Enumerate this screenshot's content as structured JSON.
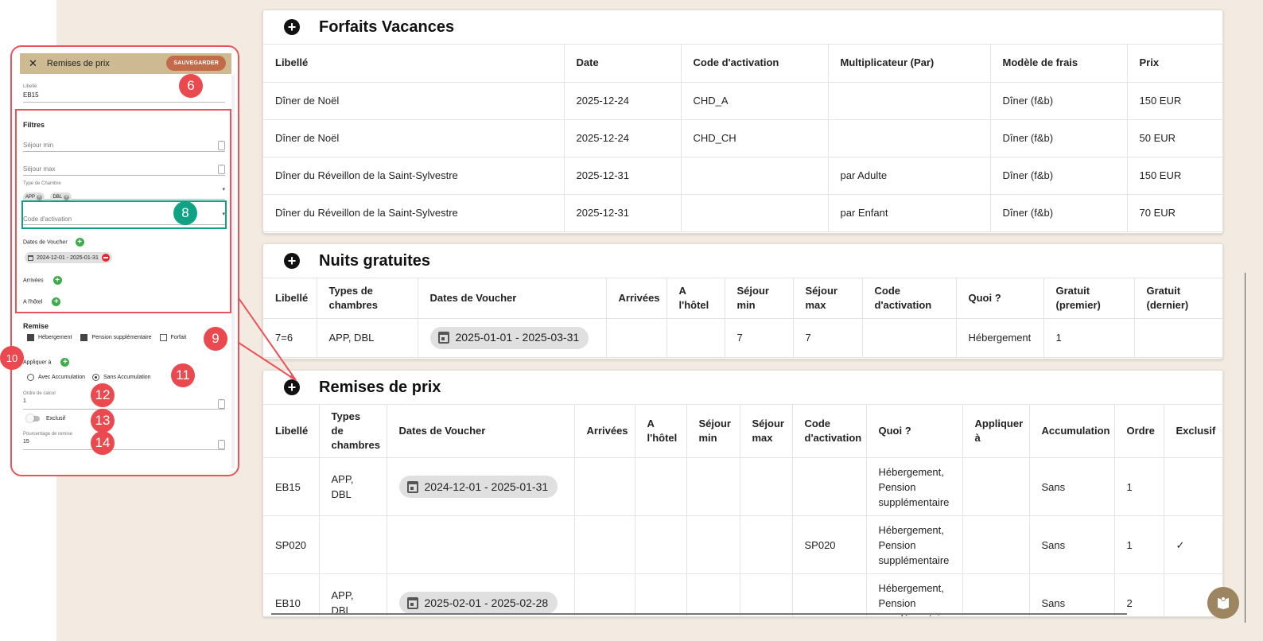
{
  "colors": {
    "accent": "#c26a4a",
    "panel_header": "#cdb992",
    "badge_red": "#ea4a4f",
    "badge_green": "#11a286",
    "page_bg": "#f3ebe1"
  },
  "forfaits": {
    "title": "Forfaits Vacances",
    "headers": [
      "Libellé",
      "Date",
      "Code d'activation",
      "Multiplicateur (Par)",
      "Modèle de frais",
      "Prix"
    ],
    "rows": [
      [
        "Dîner de Noël",
        "2025-12-24",
        "CHD_A",
        "",
        "Dîner (f&b)",
        "150 EUR"
      ],
      [
        "Dîner de Noël",
        "2025-12-24",
        "CHD_CH",
        "",
        "Dîner (f&b)",
        "50 EUR"
      ],
      [
        "Dîner du Réveillon de la Saint-Sylvestre",
        "2025-12-31",
        "",
        "par Adulte",
        "Dîner (f&b)",
        "150 EUR"
      ],
      [
        "Dîner du Réveillon de la Saint-Sylvestre",
        "2025-12-31",
        "",
        "par Enfant",
        "Dîner (f&b)",
        "70 EUR"
      ]
    ]
  },
  "nuits": {
    "title": "Nuits gratuites",
    "headers": [
      "Libellé",
      "Types de chambres",
      "Dates de Voucher",
      "Arrivées",
      "A l'hôtel",
      "Séjour min",
      "Séjour max",
      "Code d'activation",
      "Quoi ?",
      "Gratuit (premier)",
      "Gratuit (dernier)"
    ],
    "rows": [
      [
        "7=6",
        "APP, DBL",
        "2025-01-01 - 2025-03-31",
        "",
        "",
        "7",
        "7",
        "",
        "Hébergement",
        "1",
        ""
      ]
    ]
  },
  "remises": {
    "title": "Remises de prix",
    "headers": [
      "Libellé",
      "Types de chambres",
      "Dates de Voucher",
      "Arrivées",
      "A l'hôtel",
      "Séjour min",
      "Séjour max",
      "Code d'activation",
      "Quoi ?",
      "Appliquer à",
      "Accumulation",
      "Ordre",
      "Exclusif"
    ],
    "rows": [
      [
        "EB15",
        "APP, DBL",
        "2024-12-01 - 2025-01-31",
        "",
        "",
        "",
        "",
        "",
        "Hébergement, Pension supplémentaire",
        "",
        "Sans",
        "1",
        ""
      ],
      [
        "SP020",
        "",
        "",
        "",
        "",
        "",
        "",
        "SP020",
        "Hébergement, Pension supplémentaire",
        "",
        "Sans",
        "1",
        "✓"
      ],
      [
        "EB10",
        "APP, DBL",
        "2025-02-01 - 2025-02-28",
        "",
        "",
        "",
        "",
        "",
        "Hébergement, Pension supplémentaire",
        "",
        "Sans",
        "2",
        ""
      ]
    ]
  },
  "panel": {
    "close": "✕",
    "title": "Remises de prix",
    "save": "SAUVEGARDER",
    "libelle_label": "Libellé",
    "libelle_value": "EB15",
    "filtres": "Filtres",
    "sejour_min": "Séjour min",
    "sejour_max": "Séjour max",
    "type_chambre_label": "Type de Chambre",
    "type_chambre_values": [
      "APP",
      "DBL"
    ],
    "code_activation": "Code d'activation",
    "dates_voucher": "Dates de Voucher",
    "dates_voucher_chip": "2024-12-01 - 2025-01-31",
    "arrivees": "Arrivées",
    "a_lhotel": "A l'hôtel",
    "remise": "Remise",
    "hebergement": "Hébergement",
    "pension": "Pension supplémentaire",
    "forfait": "Forfait",
    "appliquer": "Appliquer à",
    "avec_accum": "Avec Accumulation",
    "sans_accum": "Sans Accumulation",
    "ordre_label": "Ordre de calcul",
    "ordre_value": "1",
    "exclusif": "Exclusif",
    "pourcentage_label": "Pourcentage de remise",
    "pourcentage_value": "15"
  },
  "badges": {
    "b6": "6",
    "b8": "8",
    "b9": "9",
    "b10": "10",
    "b11": "11",
    "b12": "12",
    "b13": "13",
    "b14": "14"
  }
}
